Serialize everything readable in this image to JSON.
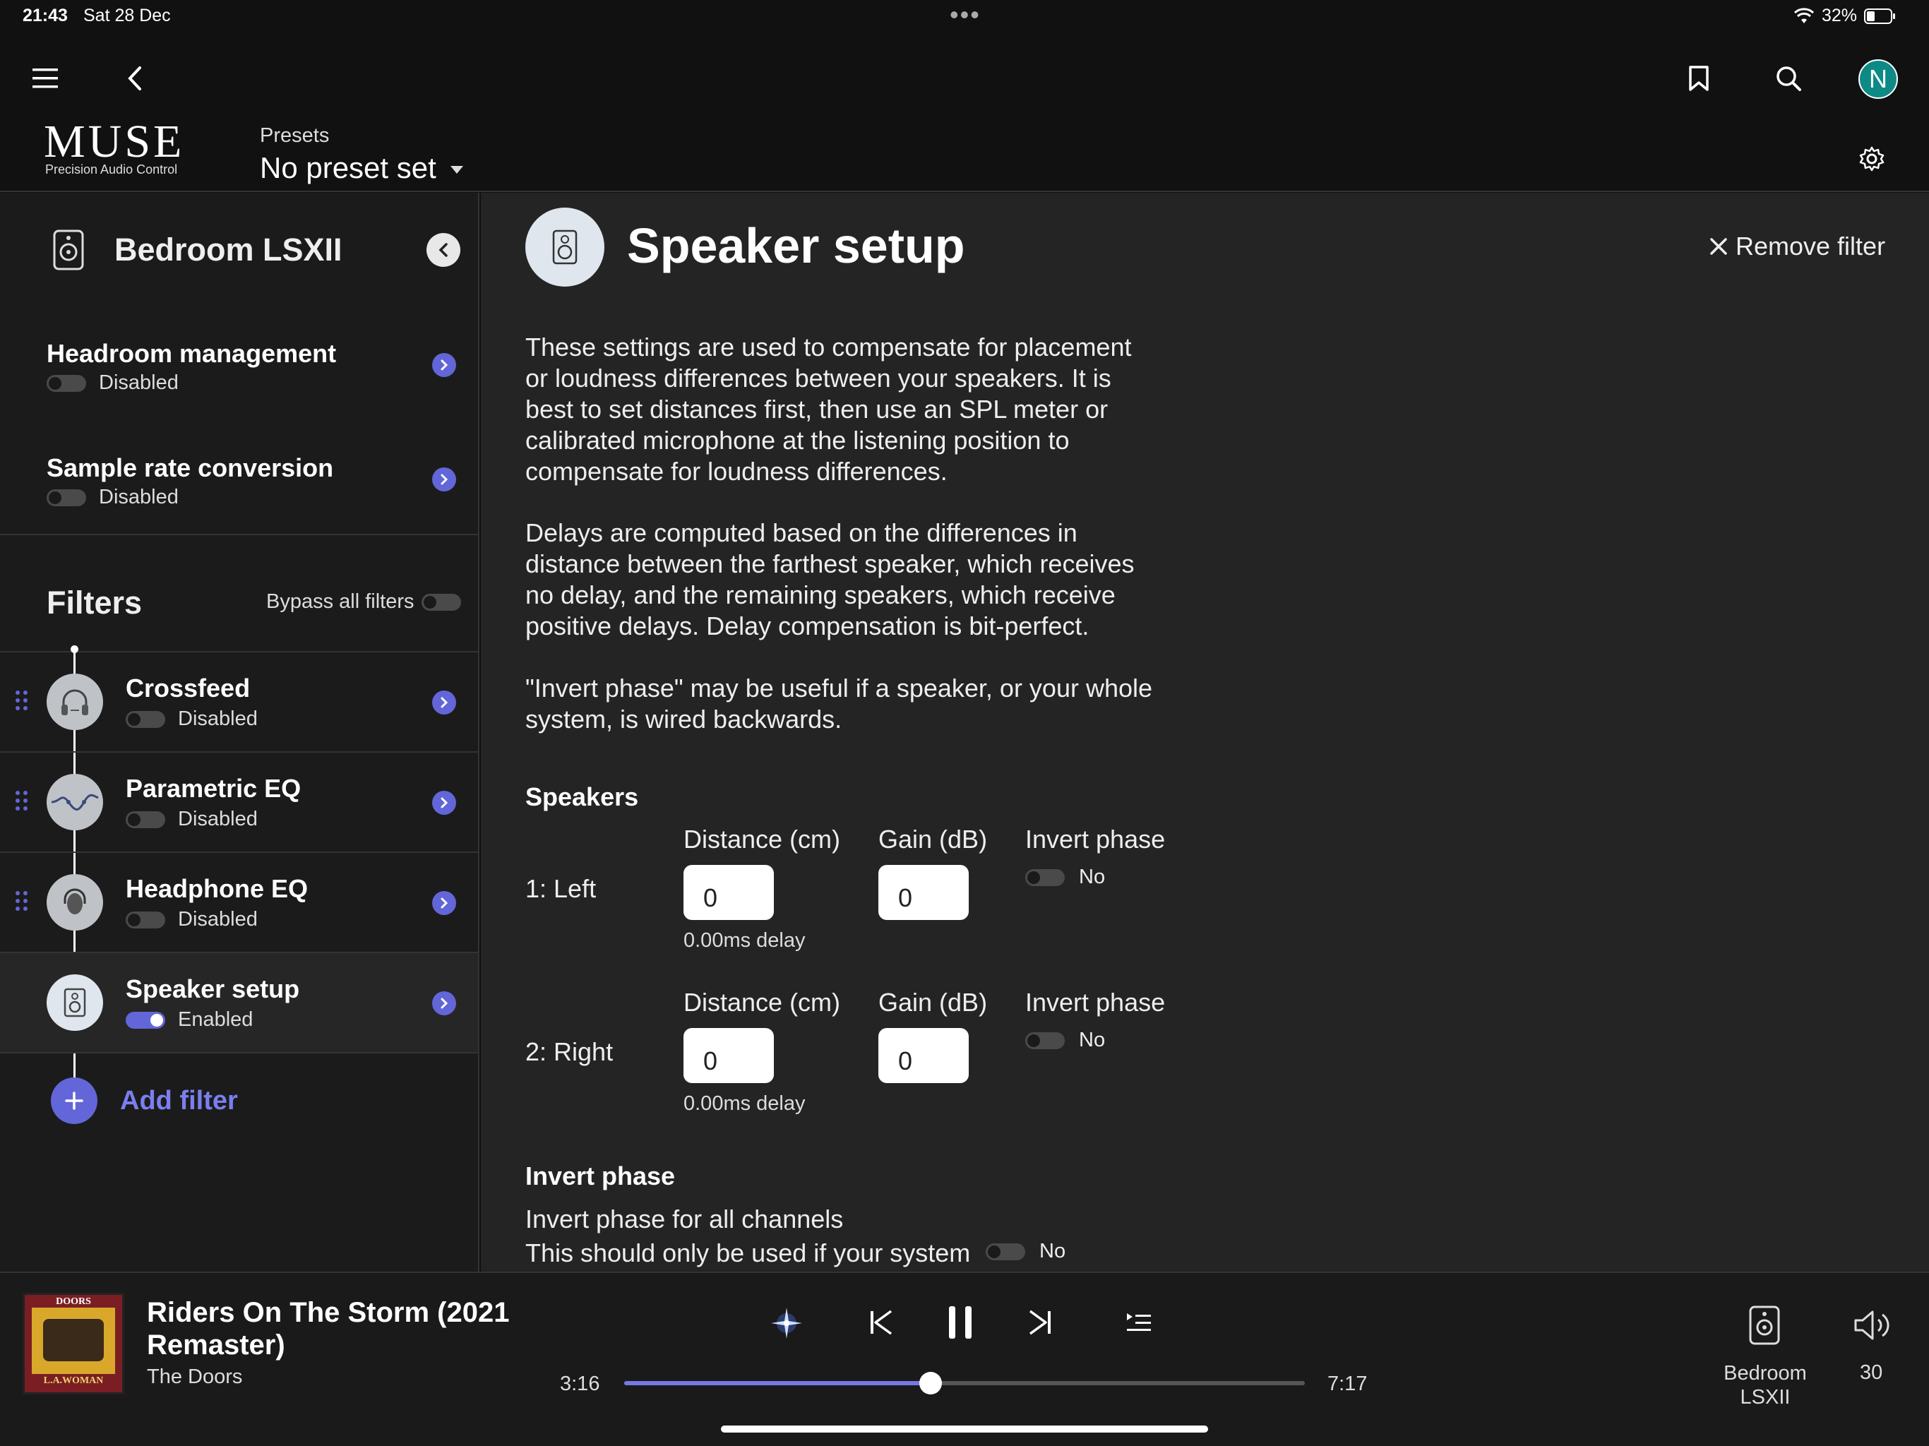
{
  "status": {
    "time": "21:43",
    "date": "Sat 28 Dec",
    "battery": "32%"
  },
  "header": {
    "logo": "MUSE",
    "tagline": "Precision Audio Control",
    "presets_label": "Presets",
    "presets_value": "No preset set",
    "avatar_initial": "N"
  },
  "sidebar": {
    "device_name": "Bedroom LSXII",
    "headroom": {
      "title": "Headroom management",
      "status": "Disabled"
    },
    "src": {
      "title": "Sample rate conversion",
      "status": "Disabled"
    },
    "filters_title": "Filters",
    "bypass_label": "Bypass all filters",
    "filters": [
      {
        "title": "Crossfeed",
        "status": "Disabled",
        "enabled": false
      },
      {
        "title": "Parametric EQ",
        "status": "Disabled",
        "enabled": false
      },
      {
        "title": "Headphone EQ",
        "status": "Disabled",
        "enabled": false
      },
      {
        "title": "Speaker setup",
        "status": "Enabled",
        "enabled": true
      }
    ],
    "add_filter": "Add filter"
  },
  "main": {
    "title": "Speaker setup",
    "remove_filter": "Remove filter",
    "para1": "These settings are used to compensate for placement or loudness differences between your speakers. It is best to set distances first, then use an SPL meter or calibrated microphone at the listening position to compensate for loudness differences.",
    "para2": "Delays are computed based on the differences in distance between the farthest speaker, which receives no delay, and the remaining speakers, which receive positive delays. Delay compensation is bit-perfect.",
    "para3": "\"Invert phase\" may be useful if a speaker, or your whole system, is wired backwards.",
    "speakers_heading": "Speakers",
    "col_distance": "Distance (cm)",
    "col_gain": "Gain (dB)",
    "col_invert": "Invert phase",
    "speakers": [
      {
        "label": "1: Left",
        "distance": "0",
        "gain": "0",
        "delay": "0.00ms delay",
        "invert": "No"
      },
      {
        "label": "2: Right",
        "distance": "0",
        "gain": "0",
        "delay": "0.00ms delay",
        "invert": "No"
      }
    ],
    "invert_heading": "Invert phase",
    "invert_all_label": "Invert phase for all channels",
    "invert_all_desc": "This should only be used if your system",
    "invert_all_value": "No"
  },
  "player": {
    "album_text_top": "DOORS",
    "album_text_bottom": "L.A.WOMAN",
    "track_title": "Riders On The Storm (2021 Remaster)",
    "artist": "The Doors",
    "elapsed": "3:16",
    "duration": "7:17",
    "progress_fraction": 0.45,
    "zone_name": "Bedroom LSXII",
    "volume": "30"
  },
  "colors": {
    "accent": "#6366d8",
    "avatar": "#0e8a86"
  }
}
